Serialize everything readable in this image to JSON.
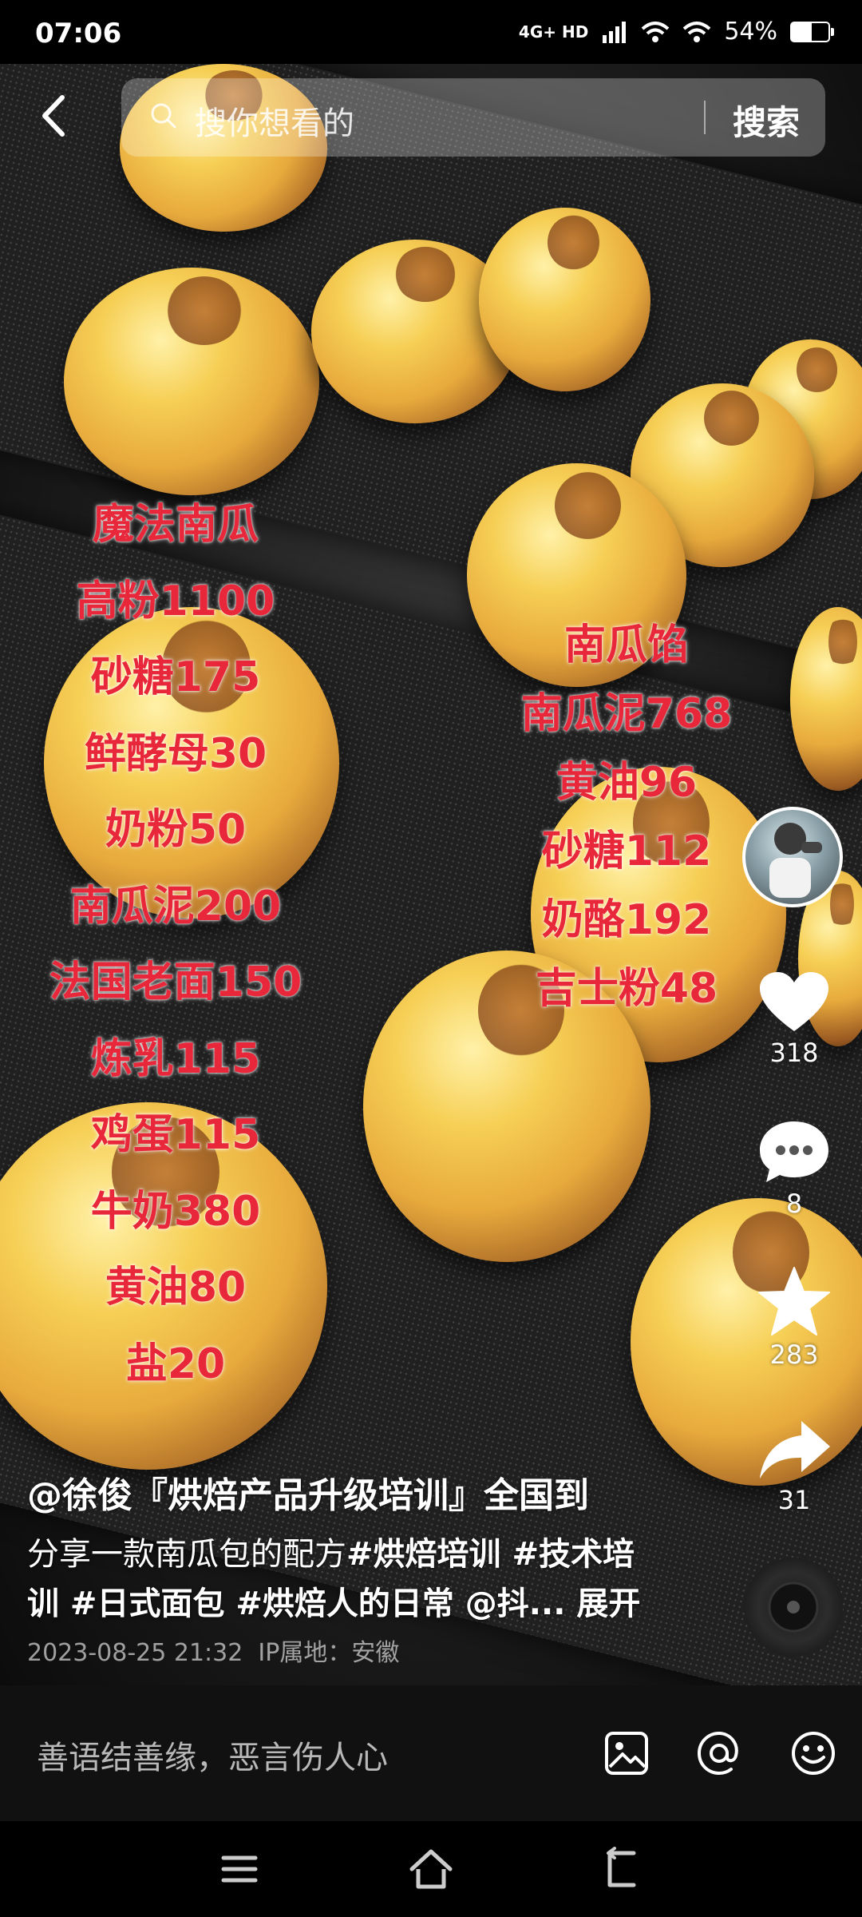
{
  "status_bar": {
    "time": "07:06",
    "network": "4G+ HD",
    "battery": "54%",
    "battery_level": 0.54
  },
  "search": {
    "placeholder": "搜你想看的",
    "button": "搜索"
  },
  "recipe_left": [
    "魔法南瓜",
    "高粉1100",
    "砂糖175",
    "鲜酵母30",
    "奶粉50",
    "南瓜泥200",
    "法国老面150",
    "炼乳115",
    "鸡蛋115",
    "牛奶380",
    "黄油80",
    "盐20"
  ],
  "recipe_right": [
    "南瓜馅",
    "南瓜泥768",
    "黄油96",
    "砂糖112",
    "奶酪192",
    "吉士粉48"
  ],
  "actions": {
    "likes": "318",
    "comments": "8",
    "favorites": "283",
    "shares": "31"
  },
  "post": {
    "author": "@徐俊『烘焙产品升级培训』全国到",
    "caption_text": "分享一款南瓜包的配方",
    "tags_1": "#烘焙培训 #技术培",
    "tags_2": "训 #日式面包 #烘焙人的日常 @抖...",
    "expand": "展开",
    "timestamp": "2023-08-25 21:32",
    "ip_location": "IP属地：安徽"
  },
  "comment_bar": {
    "placeholder": "善语结善缘，恶言伤人心"
  }
}
